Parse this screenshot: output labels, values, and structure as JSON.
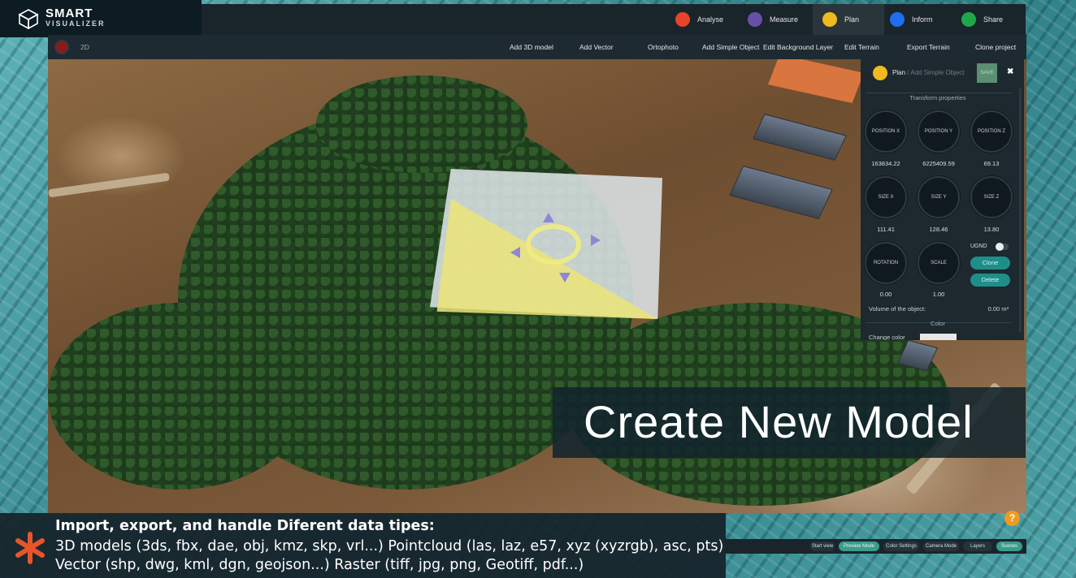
{
  "app": {
    "logo_line1": "SMART",
    "logo_line2": "VISUALIZER"
  },
  "topbar": {
    "modes": [
      {
        "label": "Analyse",
        "color": "#e8442b",
        "icon": "analyse-dot-icon"
      },
      {
        "label": "Measure",
        "color": "#6a4fa8",
        "icon": "measure-dot-icon"
      },
      {
        "label": "Plan",
        "color": "#f0b91e",
        "icon": "plan-dot-icon",
        "active": true
      },
      {
        "label": "Inform",
        "color": "#1e6ff0",
        "icon": "inform-dot-icon"
      },
      {
        "label": "Share",
        "color": "#1ea84a",
        "icon": "share-dot-icon"
      }
    ]
  },
  "subbar": {
    "view_label": "2D",
    "items": [
      "Add 3D model",
      "Add Vector",
      "Ortophoto",
      "Add Simple Object",
      "Edit Background Layer",
      "Edit Terrain",
      "Export Terrain",
      "Clone project"
    ]
  },
  "panel": {
    "crumb_main": "Plan",
    "crumb_sep": " / ",
    "crumb_sub": "Add Simple Object",
    "save_label": "SAVE",
    "close_label": "✖",
    "section_transform": "Transform properties",
    "knobs": [
      {
        "label": "POSITION X",
        "value": "163834.22"
      },
      {
        "label": "POSITION Y",
        "value": "6225409.59"
      },
      {
        "label": "POSITION Z",
        "value": "69.13"
      },
      {
        "label": "SIZE X",
        "value": "111.41"
      },
      {
        "label": "SIZE Y",
        "value": "128.46"
      },
      {
        "label": "SIZE Z",
        "value": "13.80"
      },
      {
        "label": "ROTATION",
        "value": "0.00"
      },
      {
        "label": "SCALE",
        "value": "1.00"
      }
    ],
    "ugnd_label": "UGND",
    "clone_label": "Clone",
    "delete_label": "Delete",
    "volume_label": "Volume of the object:",
    "volume_value": "0.00 m³",
    "section_color": "Color",
    "change_color_label": "Change color"
  },
  "banner": {
    "text": "Create New Model"
  },
  "caption": {
    "line1": "Import, export, and handle Diferent data tipes:",
    "line2": "3D models (3ds, fbx, dae, obj, kmz, skp, vrl...) Pointcloud (las, laz, e57, xyz (xyzrgb), asc, pts)",
    "line3": "Vector (shp, dwg, kml, dgn, geojson...) Raster (tiff, jpg, png, Geotiff, pdf...)"
  },
  "bottombar": {
    "buttons": [
      {
        "label": "Start view",
        "active": false
      },
      {
        "label": "Preview Mode",
        "active": true
      },
      {
        "label": "Color Settings",
        "active": false
      },
      {
        "label": "Camera Mode",
        "active": false
      },
      {
        "label": "Layers",
        "active": false
      },
      {
        "label": "Scenes",
        "active": true
      }
    ]
  },
  "help_label": "?"
}
